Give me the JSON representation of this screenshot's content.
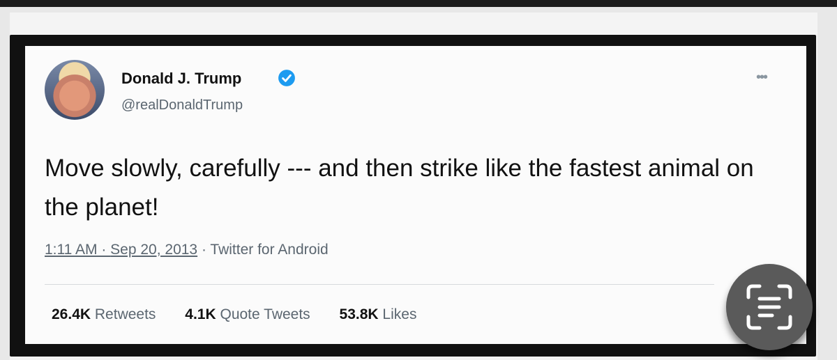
{
  "tweet": {
    "author_name": "Donald J. Trump",
    "handle": "@realDonaldTrump",
    "more_icon": "•••",
    "text": "Move slowly, carefully --- and then strike like the fastest animal on the planet!",
    "time": "1:11 AM",
    "separator": " · ",
    "date": "Sep 20, 2013",
    "source": "Twitter for Android",
    "stats": {
      "retweets_count": "26.4K",
      "retweets_label": "Retweets",
      "quotes_count": "4.1K",
      "quotes_label": "Quote Tweets",
      "likes_count": "53.8K",
      "likes_label": "Likes"
    }
  },
  "icons": {
    "verified": "verified-badge-icon",
    "scan": "text-scan-icon"
  },
  "colors": {
    "verified_blue": "#1d9bf0",
    "frame": "#111111",
    "card": "#fbfbfb"
  }
}
